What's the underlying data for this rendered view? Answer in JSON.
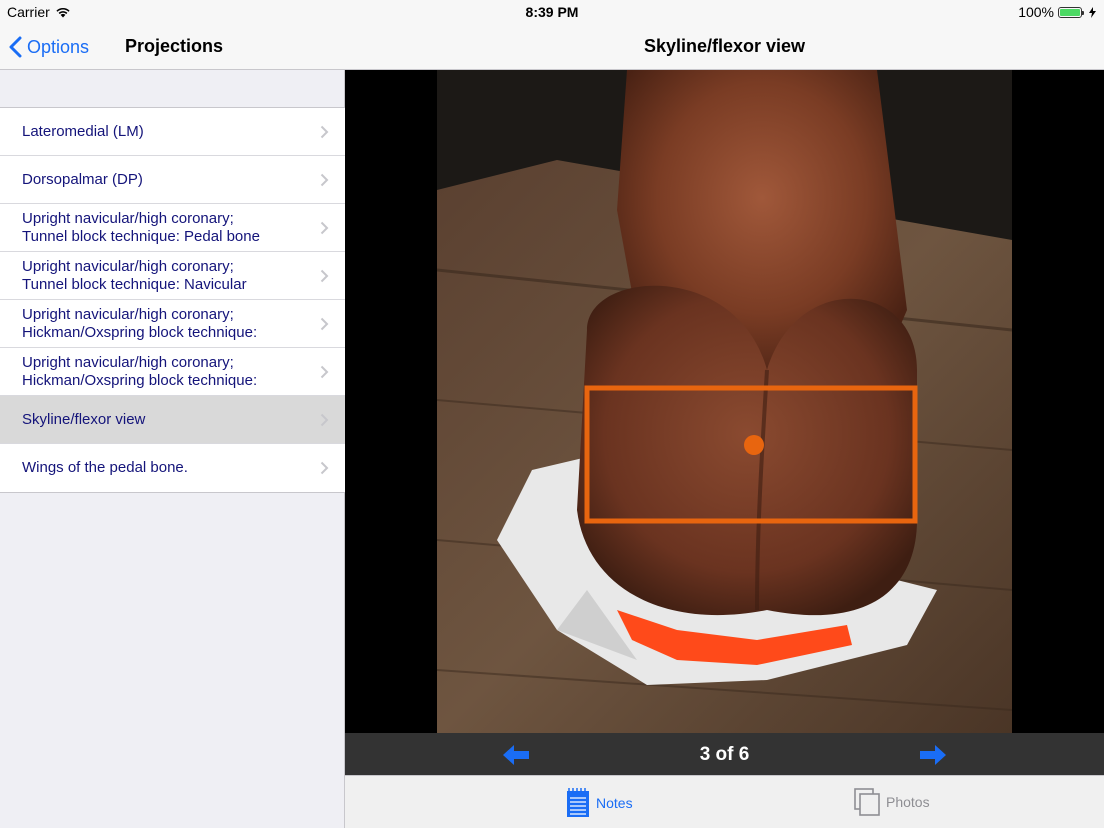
{
  "status_bar": {
    "carrier": "Carrier",
    "time": "8:39 PM",
    "battery": "100%"
  },
  "master": {
    "back_label": "Options",
    "title": "Projections",
    "items": [
      {
        "line1": "Lateromedial (LM)",
        "line2": ""
      },
      {
        "line1": "Dorsopalmar (DP)",
        "line2": ""
      },
      {
        "line1": "Upright navicular/high coronary;",
        "line2": "Tunnel block technique: Pedal bone"
      },
      {
        "line1": "Upright navicular/high coronary;",
        "line2": "Tunnel block technique: Navicular"
      },
      {
        "line1": "Upright navicular/high coronary;",
        "line2": "Hickman/Oxspring block technique:"
      },
      {
        "line1": "Upright navicular/high coronary;",
        "line2": "Hickman/Oxspring block technique:"
      },
      {
        "line1": "Skyline/flexor view",
        "line2": ""
      },
      {
        "line1": "Wings of the pedal bone.",
        "line2": ""
      }
    ],
    "selected_index": 6
  },
  "detail": {
    "title": "Skyline/flexor view",
    "pager": {
      "current": 3,
      "total": 6,
      "label": "3 of 6"
    },
    "tabs": {
      "notes": "Notes",
      "photos": "Photos"
    },
    "active_tab": "notes"
  },
  "colors": {
    "accent": "#1a6df5",
    "list_text": "#14147a",
    "marker_orange": "#e8650f",
    "pager_bg": "#333333"
  },
  "icons": [
    "back-chevron-icon",
    "wifi-icon",
    "battery-icon",
    "charging-icon",
    "disclosure-chevron-icon",
    "left-arrow-icon",
    "right-arrow-icon",
    "notes-icon",
    "photos-icon"
  ]
}
